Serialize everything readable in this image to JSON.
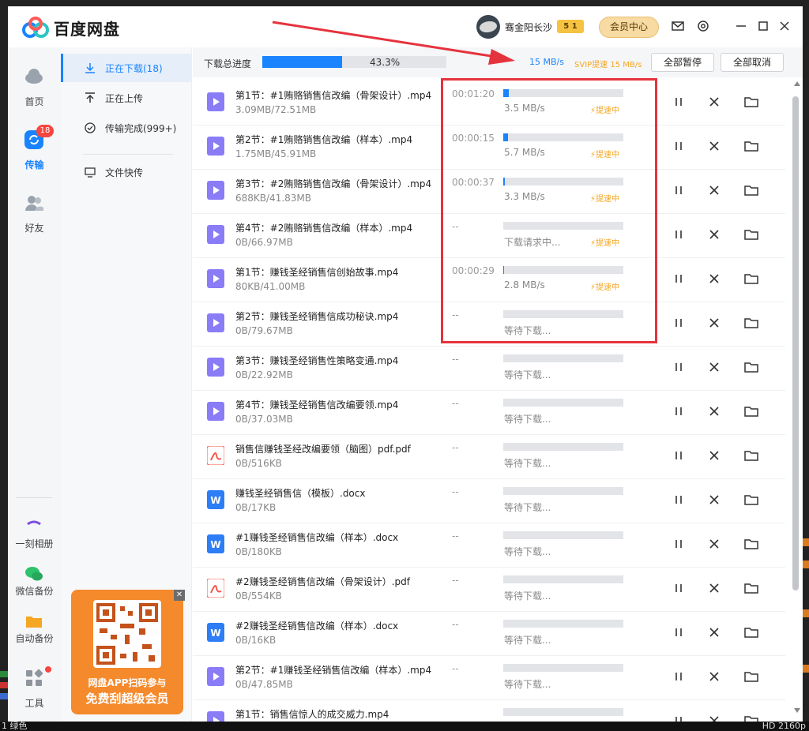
{
  "app": {
    "title": "百度网盘",
    "username": "骞金阳长沙",
    "vip_level": "5 1",
    "member_center": "会员中心"
  },
  "leftnav": {
    "home": "首页",
    "transfer": "传输",
    "transfer_badge": "18",
    "friends": "好友",
    "moment_album": "一刻相册",
    "wechat_backup": "微信备份",
    "auto_backup": "自动备份",
    "tools": "工具"
  },
  "subnav": {
    "downloading": "正在下载(18)",
    "uploading": "正在上传",
    "completed": "传输完成(999+)",
    "quick_transfer": "文件快传"
  },
  "promo": {
    "line1": "网盘APP扫码参与",
    "line2": "免费刮超级会员"
  },
  "header": {
    "label": "下载总进度",
    "percent": "43.3%",
    "progress": 0.433,
    "speed": "15 MB/s",
    "svip": "SVIP提速 15 MB/s",
    "pause_all": "全部暂停",
    "cancel_all": "全部取消"
  },
  "colors": {
    "accent": "#1a84ff",
    "boost": "#f5a623",
    "annotation": "#e5333d",
    "video": "#8a7cf6",
    "pdf": "#f5574a",
    "doc": "#2d7df6"
  },
  "boost_label": "提速中",
  "rows": [
    {
      "type": "video",
      "name": "第1节：#1贿赂销售信改编（骨架设计）.mp4",
      "size": "3.09MB/72.51MB",
      "time": "00:01:20",
      "progress": 0.043,
      "status": "3.5 MB/s",
      "boost": true
    },
    {
      "type": "video",
      "name": "第2节：#1贿赂销售信改编（样本）.mp4",
      "size": "1.75MB/45.91MB",
      "time": "00:00:15",
      "progress": 0.038,
      "status": "5.7 MB/s",
      "boost": true
    },
    {
      "type": "video",
      "name": "第3节：#2贿赂销售信改编（骨架设计）.mp4",
      "size": "688KB/41.83MB",
      "time": "00:00:37",
      "progress": 0.016,
      "status": "3.3 MB/s",
      "boost": true
    },
    {
      "type": "video",
      "name": "第4节：#2贿赂销售信改编（样本）.mp4",
      "size": "0B/66.97MB",
      "time": "--",
      "progress": 0,
      "status": "下载请求中...",
      "boost": true
    },
    {
      "type": "video",
      "name": "第1节：赚钱圣经销售信创始故事.mp4",
      "size": "80KB/41.00MB",
      "time": "00:00:29",
      "progress": 0.002,
      "status": "2.8 MB/s",
      "boost": true
    },
    {
      "type": "video",
      "name": "第2节：赚钱圣经销售信成功秘诀.mp4",
      "size": "0B/79.67MB",
      "time": "--",
      "progress": 0,
      "status": "等待下载...",
      "boost": false
    },
    {
      "type": "video",
      "name": "第3节：赚钱圣经销售性策略变通.mp4",
      "size": "0B/22.92MB",
      "time": "--",
      "progress": 0,
      "status": "等待下载...",
      "boost": false
    },
    {
      "type": "video",
      "name": "第4节：赚钱圣经销售信改编要领.mp4",
      "size": "0B/37.03MB",
      "time": "--",
      "progress": 0,
      "status": "等待下载...",
      "boost": false
    },
    {
      "type": "pdf",
      "name": "销售信赚钱圣经改编要领（脑图）pdf.pdf",
      "size": "0B/516KB",
      "time": "--",
      "progress": 0,
      "status": "等待下载...",
      "boost": false
    },
    {
      "type": "doc",
      "name": "赚钱圣经销售信（模板）.docx",
      "size": "0B/17KB",
      "time": "--",
      "progress": 0,
      "status": "等待下载...",
      "boost": false
    },
    {
      "type": "doc",
      "name": "#1赚钱圣经销售信改编（样本）.docx",
      "size": "0B/180KB",
      "time": "--",
      "progress": 0,
      "status": "等待下载...",
      "boost": false
    },
    {
      "type": "pdf",
      "name": "#2赚钱圣经销售信改编（骨架设计）.pdf",
      "size": "0B/554KB",
      "time": "--",
      "progress": 0,
      "status": "等待下载...",
      "boost": false
    },
    {
      "type": "doc",
      "name": "#2赚钱圣经销售信改编（样本）.docx",
      "size": "0B/16KB",
      "time": "--",
      "progress": 0,
      "status": "等待下载...",
      "boost": false
    },
    {
      "type": "video",
      "name": "第2节：#1赚钱圣经销售信改编（样本）.mp4",
      "size": "0B/47.85MB",
      "time": "--",
      "progress": 0,
      "status": "等待下载...",
      "boost": false
    },
    {
      "type": "video",
      "name": "第1节：销售信惊人的成交威力.mp4",
      "size": "",
      "time": "",
      "progress": 0,
      "status": "",
      "boost": false
    }
  ],
  "desktop": {
    "bottom_left": "1 绿色",
    "bottom_right": "HD 2160p"
  }
}
